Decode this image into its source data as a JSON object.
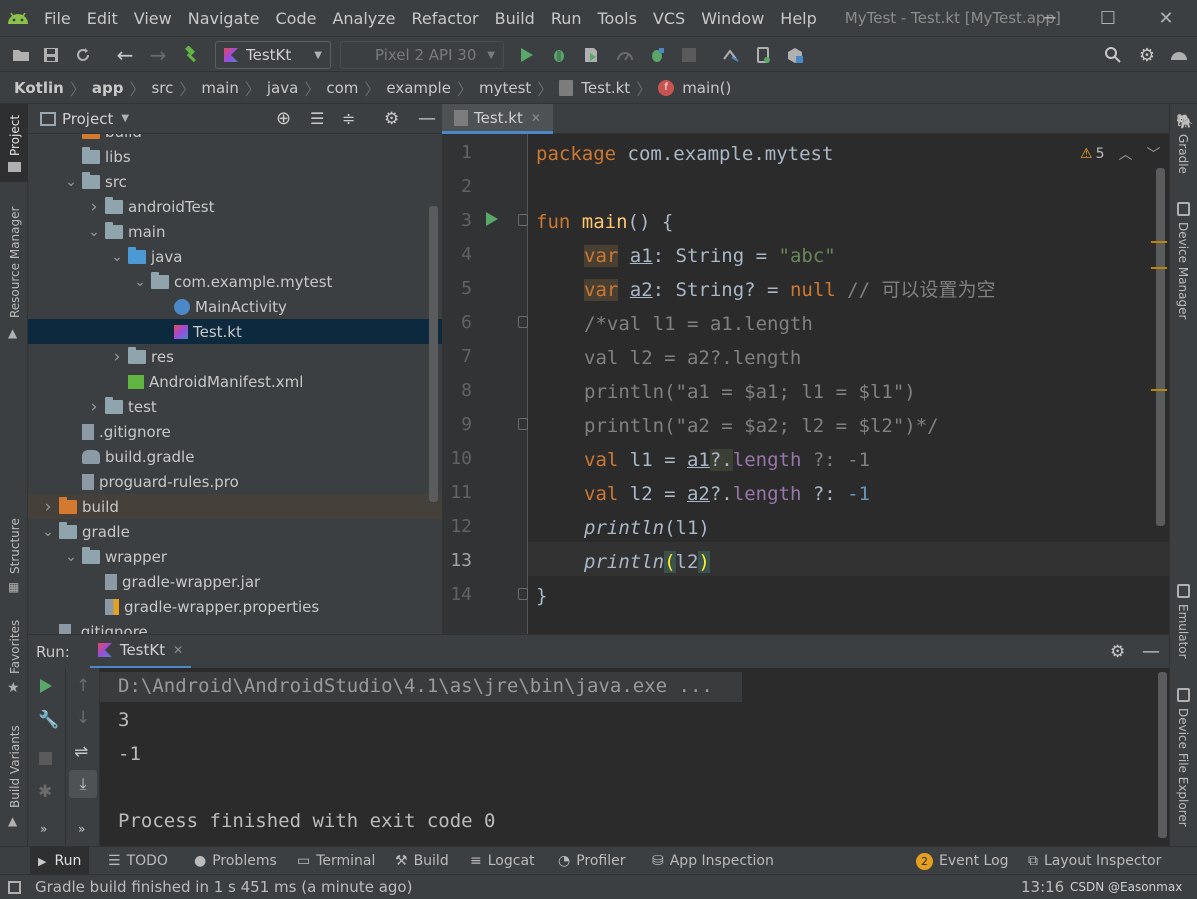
{
  "menubar": {
    "items": [
      "File",
      "Edit",
      "View",
      "Navigate",
      "Code",
      "Analyze",
      "Refactor",
      "Build",
      "Run",
      "Tools",
      "VCS",
      "Window",
      "Help"
    ],
    "window_title": "MyTest - Test.kt [MyTest.app]"
  },
  "toolbar": {
    "run_config": "TestKt",
    "device": "Pixel 2 API 30"
  },
  "breadcrumb": [
    "Kotlin",
    "app",
    "src",
    "main",
    "java",
    "com",
    "example",
    "mytest",
    "Test.kt",
    "main()"
  ],
  "project_panel": {
    "title": "Project",
    "rows": [
      {
        "label": "build",
        "indent": 3,
        "arrow": "",
        "icon": "folder-orange"
      },
      {
        "label": "libs",
        "indent": 3,
        "arrow": "",
        "icon": "folder"
      },
      {
        "label": "src",
        "indent": 3,
        "arrow": "v",
        "icon": "folder"
      },
      {
        "label": "androidTest",
        "indent": 4,
        "arrow": ">",
        "icon": "folder"
      },
      {
        "label": "main",
        "indent": 4,
        "arrow": "v",
        "icon": "folder"
      },
      {
        "label": "java",
        "indent": 5,
        "arrow": "v",
        "icon": "folder-blue"
      },
      {
        "label": "com.example.mytest",
        "indent": 6,
        "arrow": "v",
        "icon": "package"
      },
      {
        "label": "MainActivity",
        "indent": 7,
        "arrow": "",
        "icon": "activity"
      },
      {
        "label": "Test.kt",
        "indent": 7,
        "arrow": "",
        "icon": "kotlin"
      },
      {
        "label": "res",
        "indent": 5,
        "arrow": ">",
        "icon": "folder-res"
      },
      {
        "label": "AndroidManifest.xml",
        "indent": 5,
        "arrow": "",
        "icon": "manifest"
      },
      {
        "label": "test",
        "indent": 4,
        "arrow": ">",
        "icon": "folder"
      },
      {
        "label": ".gitignore",
        "indent": 3,
        "arrow": "",
        "icon": "file"
      },
      {
        "label": "build.gradle",
        "indent": 3,
        "arrow": "",
        "icon": "gradle"
      },
      {
        "label": "proguard-rules.pro",
        "indent": 3,
        "arrow": "",
        "icon": "file"
      },
      {
        "label": "build",
        "indent": 2,
        "arrow": ">",
        "icon": "folder-orange"
      },
      {
        "label": "gradle",
        "indent": 2,
        "arrow": "v",
        "icon": "folder"
      },
      {
        "label": "wrapper",
        "indent": 3,
        "arrow": "v",
        "icon": "folder"
      },
      {
        "label": "gradle-wrapper.jar",
        "indent": 4,
        "arrow": "",
        "icon": "jar"
      },
      {
        "label": "gradle-wrapper.properties",
        "indent": 4,
        "arrow": "",
        "icon": "properties"
      },
      {
        "label": ".gitignore",
        "indent": 2,
        "arrow": "",
        "icon": "file"
      }
    ]
  },
  "editor": {
    "tab": "Test.kt",
    "warnings": "5",
    "line_numbers": [
      "1",
      "2",
      "3",
      "4",
      "5",
      "6",
      "7",
      "8",
      "9",
      "10",
      "11",
      "12",
      "13",
      "14"
    ],
    "code": {
      "l1_kw": "package",
      "l1_rest": " com.example.mytest",
      "l3_kw": "fun",
      "l3_fn": " main",
      "l3_rest": "() {",
      "l4_kw": "var",
      "l4_name": "a1",
      "l4_type": ": String = ",
      "l4_str": "\"abc\"",
      "l5_kw": "var",
      "l5_name": "a2",
      "l5_type": ": String? = ",
      "l5_null": "null",
      "l5_cm": " // 可以设置为空",
      "l6": "/*val l1 = a1.length",
      "l7": "val l2 = a2?.length",
      "l8": "println(\"a1 = $a1; l1 = $l1\")",
      "l9": "println(\"a2 = $a2; l2 = $l2\")*/",
      "l10_kw": "val",
      "l10_a": " l1 = ",
      "l10_v": "a1",
      "l10_op": "?.",
      "l10_p": "length",
      "l10_e": " ?: ",
      "l10_n": "-1",
      "l11_kw": "val",
      "l11_a": " l2 = ",
      "l11_v": "a2",
      "l11_op": "?.",
      "l11_p": "length",
      "l11_e": " ?: ",
      "l11_n": "-1",
      "l12_fn": "println",
      "l12_rest": "(l1)",
      "l13_fn": "println",
      "l13_p1": "(",
      "l13_arg": "l2",
      "l13_p2": ")",
      "l14": "}"
    }
  },
  "run_panel": {
    "label": "Run:",
    "tab": "TestKt",
    "output": [
      "D:\\Android\\AndroidStudio\\4.1\\as\\jre\\bin\\java.exe ...",
      "3",
      "-1",
      "",
      "Process finished with exit code 0"
    ]
  },
  "left_strip": [
    "Project",
    "Resource Manager",
    "Structure",
    "Favorites",
    "Build Variants"
  ],
  "right_strip": [
    "Gradle",
    "Device Manager",
    "Emulator",
    "Device File Explorer"
  ],
  "bottom_tools": [
    "Run",
    "TODO",
    "Problems",
    "Terminal",
    "Build",
    "Logcat",
    "Profiler",
    "App Inspection"
  ],
  "bottom_right": {
    "event_count": "2",
    "event_log": "Event Log",
    "layout_inspector": "Layout Inspector"
  },
  "status": {
    "message": "Gradle build finished in 1 s 451 ms (a minute ago)",
    "position": "13:16",
    "watermark": "CSDN @Easonmax"
  }
}
